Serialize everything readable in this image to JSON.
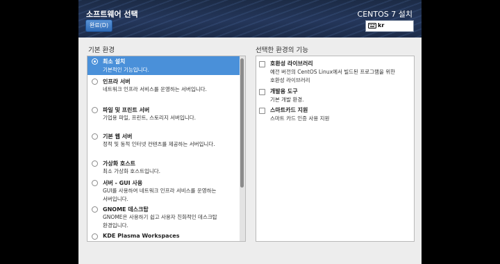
{
  "header": {
    "title": "소프트웨어 선택",
    "product": "CENTOS 7 설치",
    "done_button": "완료(D)",
    "keyboard_layout": "kr",
    "keyboard_icon": "keyboard-icon"
  },
  "environment": {
    "label": "기본 환경",
    "items": [
      {
        "name": "최소 설치",
        "desc": [
          "기본적인 기능입니다."
        ],
        "selected": true
      },
      {
        "name": "인프라 서버",
        "desc": [
          "네트워크 인프라 서비스를 운영하는 서버입니다."
        ],
        "selected": false
      },
      {
        "name": "파일 및 프린트 서버",
        "desc": [
          "기업용 파일, 프린트, 스토리지 서버입니다."
        ],
        "selected": false
      },
      {
        "name": "기본 웹 서버",
        "desc": [
          "정적 및 동적 인터넷 컨텐츠를 제공하는 서버입니다."
        ],
        "selected": false
      },
      {
        "name": "가상화 호스트",
        "desc": [
          "최소 가상화 호스트입니다."
        ],
        "selected": false
      },
      {
        "name": "서버 - GUI 사용",
        "desc": [
          "GUI를 사용하여 네트워크 인프라 서비스를 운영하는",
          "서버입니다."
        ],
        "selected": false
      },
      {
        "name": "GNOME 데스크탑",
        "desc": [
          "GNOME은 사용하기 쉽고 사용자 친화적인 데스크탑",
          "환경입니다."
        ],
        "selected": false
      },
      {
        "name": "KDE Plasma Workspaces",
        "desc": [],
        "selected": false
      }
    ]
  },
  "addons": {
    "label": "선택한 환경의 기능",
    "items": [
      {
        "name": "호환성 라이브러리",
        "desc": [
          "예전 버전의 CentOS Linux에서 빌드된 프로그램을 위한",
          "호환성 라이브러리"
        ],
        "checked": false
      },
      {
        "name": "개발용 도구",
        "desc": [
          "기본 개발 환경."
        ],
        "checked": false
      },
      {
        "name": "스마트카드 지원",
        "desc": [
          "스마트 카드 인증 사용 지원"
        ],
        "checked": false
      }
    ]
  },
  "colors": {
    "header_bg": "#24365a",
    "selection": "#4a90d9",
    "done_button": "#3f7dc6"
  }
}
